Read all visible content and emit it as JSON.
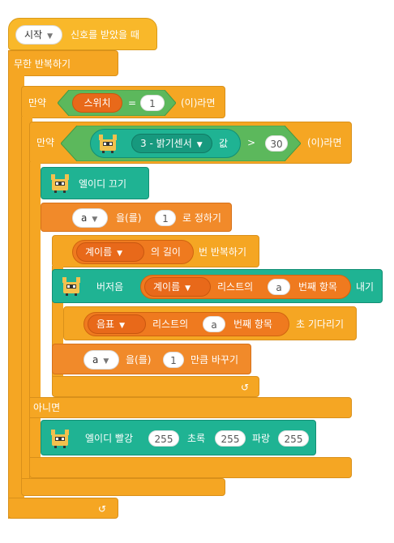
{
  "event": {
    "dropdown": "시작",
    "label": "신호를 받았을 때"
  },
  "forever": {
    "label": "무한 반복하기"
  },
  "if1": {
    "label": "만약",
    "condition": {
      "reporter": "스위치",
      "op": "=",
      "value": "1"
    },
    "suffix": "(이)라면"
  },
  "if2": {
    "label": "만약",
    "condition": {
      "sensor": "3 - 밝기센서",
      "sensor_suffix": "값",
      "op": ">",
      "value": "30"
    },
    "suffix": "(이)라면"
  },
  "led_off": {
    "label": "엘이디 끄기"
  },
  "set_var": {
    "var": "a",
    "text1": "을(를)",
    "value": "1",
    "text2": "로 정하기"
  },
  "repeat": {
    "list": "계이름",
    "mid": "의 길이",
    "suffix": "번 반복하기"
  },
  "buzzer": {
    "label": "버저음",
    "list": "계이름",
    "item_text": "리스트의",
    "index": "a",
    "item_suffix": "번째 항목",
    "suffix": "내기"
  },
  "wait": {
    "list": "음표",
    "item_text": "리스트의",
    "index": "a",
    "item_suffix": "번째 항목",
    "suffix": "초 기다리기"
  },
  "change_var": {
    "var": "a",
    "text1": "을(를)",
    "value": "1",
    "text2": "만큼 바꾸기"
  },
  "else": {
    "label": "아니면"
  },
  "led_color": {
    "label": "엘이디 빨강",
    "red": "255",
    "green_label": "초록",
    "green": "255",
    "blue_label": "파랑",
    "blue": "255"
  },
  "icons": {
    "loop": "loop-arrow-icon",
    "robot": "robot-icon",
    "dropdown": "dropdown-arrow-icon"
  },
  "colors": {
    "control": "#f5a623",
    "event": "#f9b82a",
    "variable": "#f18a2a",
    "extension": "#1fb393",
    "operator": "#5cb85c"
  }
}
